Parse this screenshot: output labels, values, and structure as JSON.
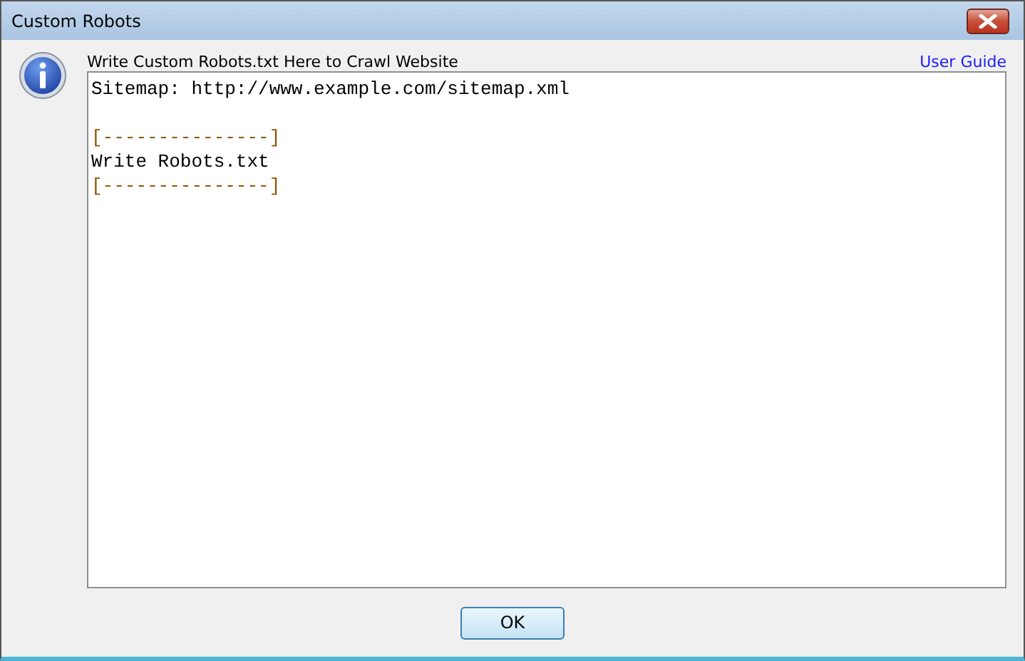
{
  "window": {
    "title": "Custom Robots"
  },
  "prompt": "Write Custom Robots.txt Here to Crawl Website",
  "help_link": "User Guide",
  "editor": {
    "lines": [
      {
        "kind": "text",
        "text": "Sitemap: http://www.example.com/sitemap.xml"
      },
      {
        "kind": "blank"
      },
      {
        "kind": "marker",
        "text": "[---------------]"
      },
      {
        "kind": "text",
        "text": "Write Robots.txt"
      },
      {
        "kind": "marker",
        "text": "[---------------]"
      }
    ]
  },
  "buttons": [
    "OK"
  ]
}
